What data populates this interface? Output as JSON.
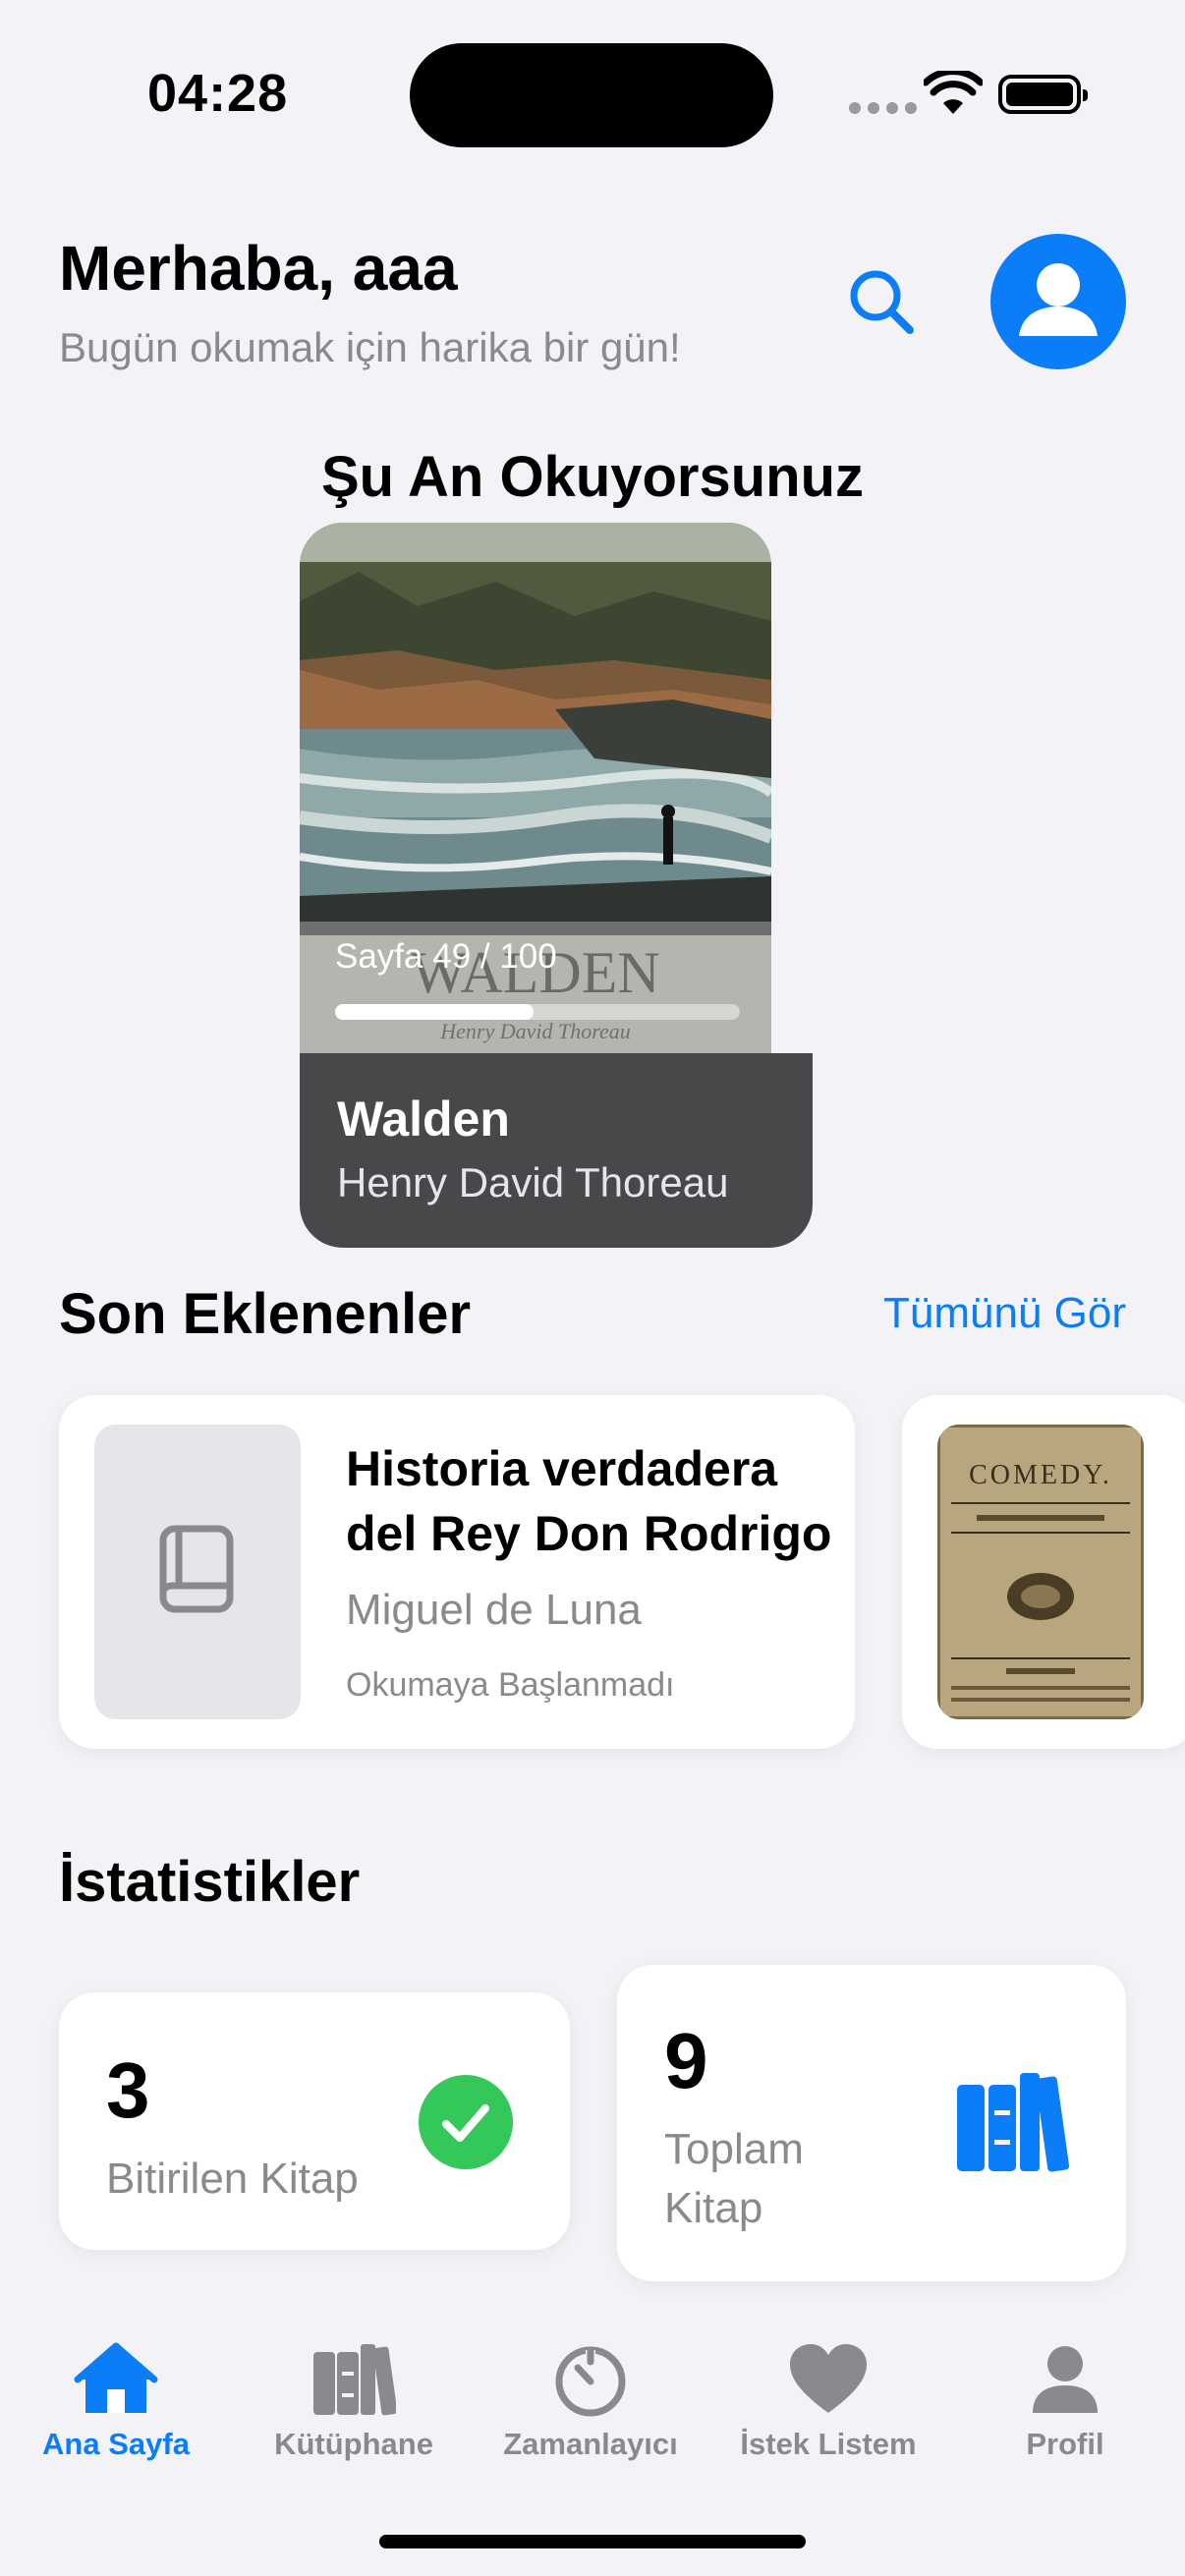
{
  "status_bar": {
    "time": "04:28"
  },
  "header": {
    "greeting": "Merhaba, aaa",
    "subtitle": "Bugün okumak için harika bir gün!"
  },
  "currently_reading": {
    "section_title": "Şu An Okuyorsunuz",
    "cover_title": "WALDEN",
    "cover_author": "Henry David Thoreau",
    "progress_text": "Sayfa 49 / 100",
    "current_page": 49,
    "total_pages": 100,
    "title": "Walden",
    "author": "Henry David Thoreau"
  },
  "recent": {
    "section_title": "Son Eklenenler",
    "see_all": "Tümünü Gör",
    "items": [
      {
        "title": "Historia verdadera del Rey Don Rodrigo",
        "author": "Miguel de Luna",
        "status": "Okumaya Başlanmadı",
        "thumb_icon": "book-icon"
      },
      {
        "cover_text": "COMEDY.",
        "thumb_icon": "comedy-cover"
      }
    ]
  },
  "stats": {
    "section_title": "İstatistikler",
    "cards": [
      {
        "value": "3",
        "label": "Bitirilen Kitap",
        "icon": "checkmark-circle-icon",
        "color": "#34c759"
      },
      {
        "value": "9",
        "label": "Toplam Kitap",
        "icon": "books-icon",
        "color": "#0a7df7"
      }
    ]
  },
  "tab_bar": {
    "items": [
      {
        "label": "Ana Sayfa",
        "icon": "home-icon",
        "active": true
      },
      {
        "label": "Kütüphane",
        "icon": "library-icon",
        "active": false
      },
      {
        "label": "Zamanlayıcı",
        "icon": "timer-icon",
        "active": false
      },
      {
        "label": "İstek Listem",
        "icon": "heart-icon",
        "active": false
      },
      {
        "label": "Profil",
        "icon": "person-icon",
        "active": false
      }
    ]
  },
  "colors": {
    "accent": "#0a7df7",
    "success": "#34c759",
    "background": "#f2f2f7"
  }
}
